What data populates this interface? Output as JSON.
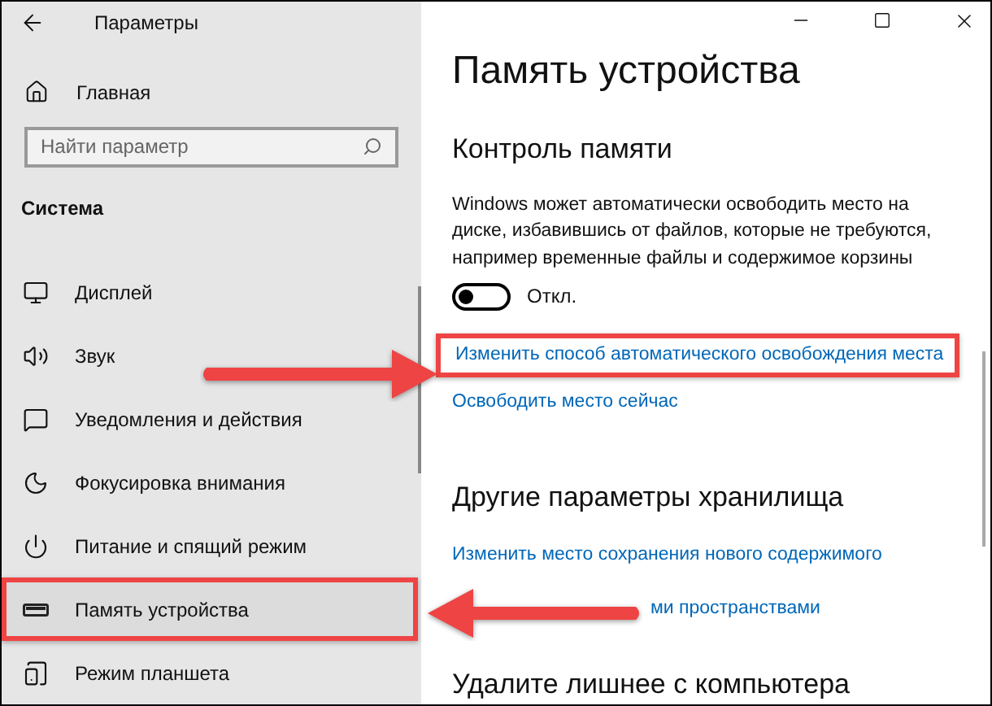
{
  "window": {
    "title": "Параметры"
  },
  "sidebar": {
    "home": "Главная",
    "search": {
      "placeholder": "Найти параметр"
    },
    "section": "Система",
    "items": [
      {
        "kind": "display",
        "label": "Дисплей",
        "selected": false
      },
      {
        "kind": "sound",
        "label": "Звук",
        "selected": false
      },
      {
        "kind": "notifications",
        "label": "Уведомления и действия",
        "selected": false
      },
      {
        "kind": "focus",
        "label": "Фокусировка внимания",
        "selected": false
      },
      {
        "kind": "power",
        "label": "Питание и спящий режим",
        "selected": false
      },
      {
        "kind": "storage",
        "label": "Память устройства",
        "selected": true
      },
      {
        "kind": "tablet",
        "label": "Режим планшета",
        "selected": false
      }
    ]
  },
  "content": {
    "title": "Память устройства",
    "storage_sense": {
      "heading": "Контроль памяти",
      "description": "Windows может автоматически освободить место на диске, избавившись от файлов, которые не требуются, например временные файлы и содержимое корзины",
      "toggle": {
        "on": false,
        "label": "Откл."
      },
      "links": [
        "Изменить способ автоматического освобождения места",
        "Освободить место сейчас"
      ]
    },
    "other": {
      "heading": "Другие параметры хранилища",
      "links": [
        "Изменить место сохранения нового содержимого",
        "ми пространствами"
      ]
    },
    "remove": {
      "heading": "Удалите лишнее с компьютера"
    }
  }
}
